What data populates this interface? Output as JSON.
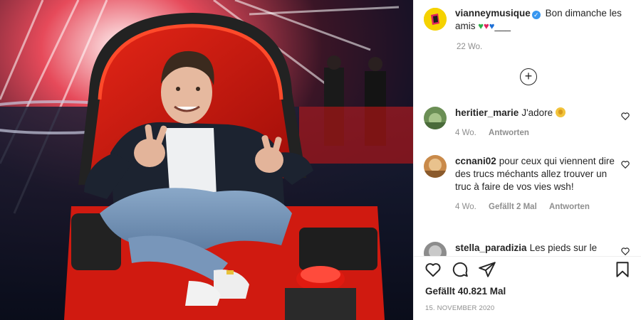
{
  "post": {
    "username": "vianneymusique",
    "verified_icon": "verified-badge-icon",
    "caption": "Bon dimanche les amis",
    "caption_suffix": "___",
    "caption_time": "22 Wo.",
    "heart_colors": [
      "#2bb04a",
      "#e0245e",
      "#1d6fd6"
    ]
  },
  "comments": [
    {
      "user": "heritier_marie",
      "text": "J'adore",
      "time": "4 Wo.",
      "likes": "",
      "reply": "Antworten"
    },
    {
      "user": "ccnani02",
      "text": "pour ceux qui viennent dire des trucs méchants allez trouver un truc à faire de vos vies wsh!",
      "time": "4 Wo.",
      "likes": "Gefällt 2 Mal",
      "reply": "Antworten"
    },
    {
      "user": "stella_paradizia",
      "text": "Les pieds sur le",
      "time": "",
      "likes": "",
      "reply": ""
    }
  ],
  "footer": {
    "likes": "Gefällt 40.821 Mal",
    "date": "15. NOVEMBER 2020"
  },
  "icons": {
    "like": "heart-icon",
    "comment": "comment-icon",
    "share": "paper-plane-icon",
    "save": "bookmark-icon",
    "load_more": "plus-circle-icon"
  }
}
